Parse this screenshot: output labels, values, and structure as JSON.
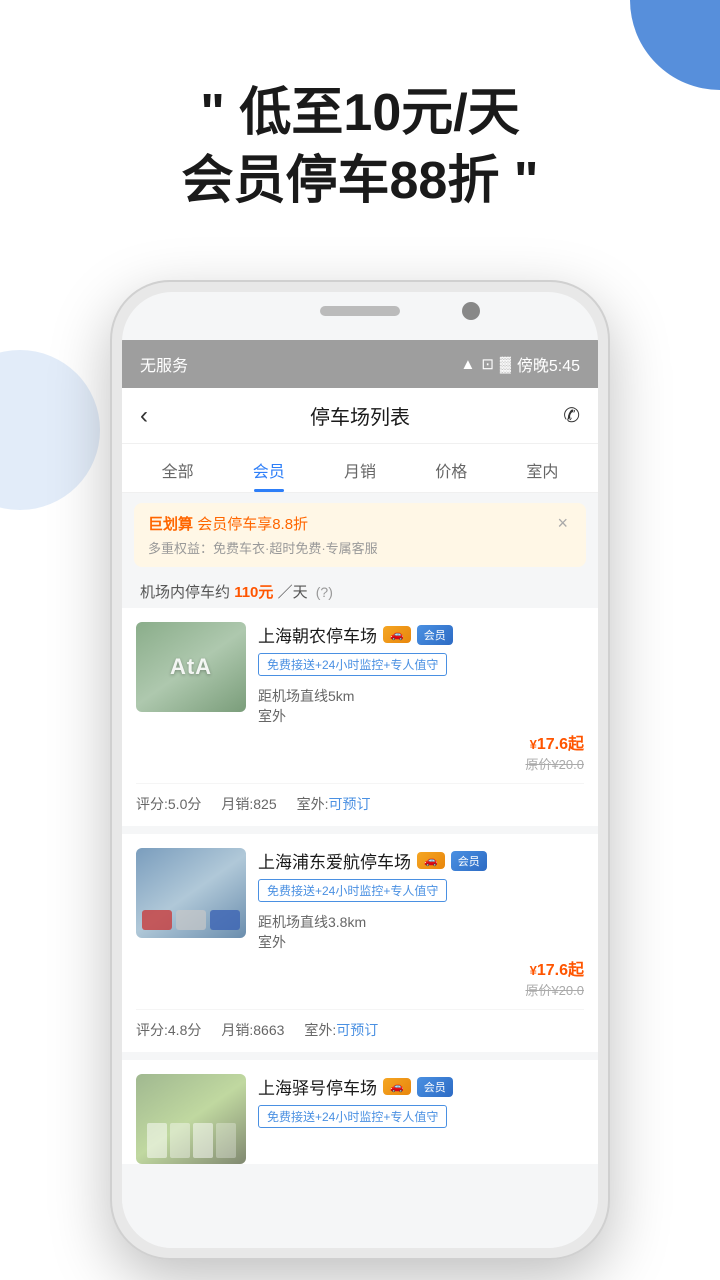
{
  "background": {
    "top_right_color": "#3a7bd5",
    "mid_left_color": "#d6e4f7"
  },
  "headline": {
    "line1": "低至10元/天",
    "line2": "会员停车88折",
    "quote_open": "“",
    "quote_close": "”"
  },
  "status_bar": {
    "signal": "无服务",
    "wifi_icon": "wifi",
    "battery_icon": "battery",
    "time": "傍晚5:45"
  },
  "header": {
    "back_icon": "‹",
    "title": "停车场列表",
    "phone_icon": "✆"
  },
  "tabs": [
    {
      "label": "全部",
      "active": false
    },
    {
      "label": "会员",
      "active": true
    },
    {
      "label": "月销",
      "active": false
    },
    {
      "label": "价格",
      "active": false
    },
    {
      "label": "室内",
      "active": false
    }
  ],
  "promo_banner": {
    "brand": "巨划算",
    "title": " 会员停车享8.8折",
    "subtitle": "多重权益：免费车衣·超时免费·专属客服",
    "close_icon": "×"
  },
  "airport_info": {
    "text1": "机场内停车约",
    "price": "110元",
    "text2": "／天",
    "question_mark": "?"
  },
  "parking_lots": [
    {
      "name": "上海朝农停车场",
      "has_vip": true,
      "has_member": true,
      "feature_tag": "免费接送+24小时监控+专人值守",
      "distance": "距机场直线5km",
      "type": "室外",
      "price": "17.6",
      "currency": "¥",
      "price_suffix": "起",
      "original_price": "原价¥20.0",
      "rating": "评分:5.0分",
      "monthly": "月销:825",
      "outdoor_status": "室外:可预订",
      "img_type": "img1"
    },
    {
      "name": "上海浦东爱航停车场",
      "has_vip": true,
      "has_member": true,
      "feature_tag": "免费接送+24小时监控+专人值守",
      "distance": "距机场直线3.8km",
      "type": "室外",
      "price": "17.6",
      "currency": "¥",
      "price_suffix": "起",
      "original_price": "原价¥20.0",
      "rating": "评分:4.8分",
      "monthly": "月销:8663",
      "outdoor_status": "室外:可预订",
      "img_type": "img2"
    },
    {
      "name": "上海驿号停车场",
      "has_vip": true,
      "has_member": true,
      "feature_tag": "免费接送+24小时监控+专人值守",
      "distance": "",
      "type": "",
      "price": "",
      "currency": "¥",
      "price_suffix": "",
      "original_price": "",
      "rating": "",
      "monthly": "",
      "outdoor_status": "",
      "img_type": "img3"
    }
  ]
}
